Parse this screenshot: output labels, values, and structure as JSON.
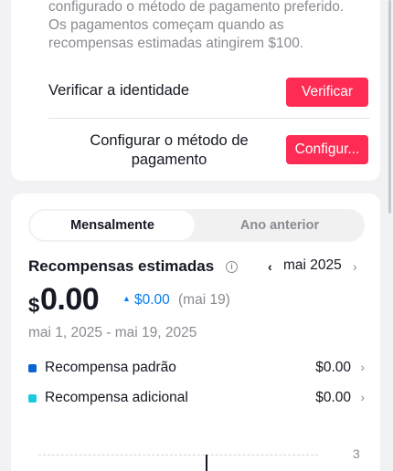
{
  "setup": {
    "intro_lines": [
      "configurado o método de pagamento preferido.",
      "Os pagamentos começam quando as",
      "recompensas estimadas atingirem $100."
    ],
    "verify": {
      "label": "Verificar a identidade",
      "button": "Verificar"
    },
    "payment": {
      "label_line1": "Configurar o método de",
      "label_line2": "pagamento",
      "button": "Configur..."
    }
  },
  "tabs": {
    "active": "Mensalmente",
    "inactive": "Ano anterior"
  },
  "rewards": {
    "title": "Recompensas estimadas",
    "info_icon": "info-icon",
    "month": "mai 2025",
    "currency": "$",
    "amount": "0.00",
    "delta_value": "$0.00",
    "delta_date": "(mai 19)",
    "date_range": "mai 1, 2025 - mai 19, 2025"
  },
  "legend": [
    {
      "label": "Recompensa padrão",
      "value": "$0.00",
      "color": "#0b63ce"
    },
    {
      "label": "Recompensa adicional",
      "value": "$0.00",
      "color": "#1ec8e0"
    }
  ],
  "chart": {
    "y_tick": "3"
  },
  "colors": {
    "accent": "#fe2c55",
    "positive": "#0a7cf0",
    "muted": "#8a8b91"
  }
}
